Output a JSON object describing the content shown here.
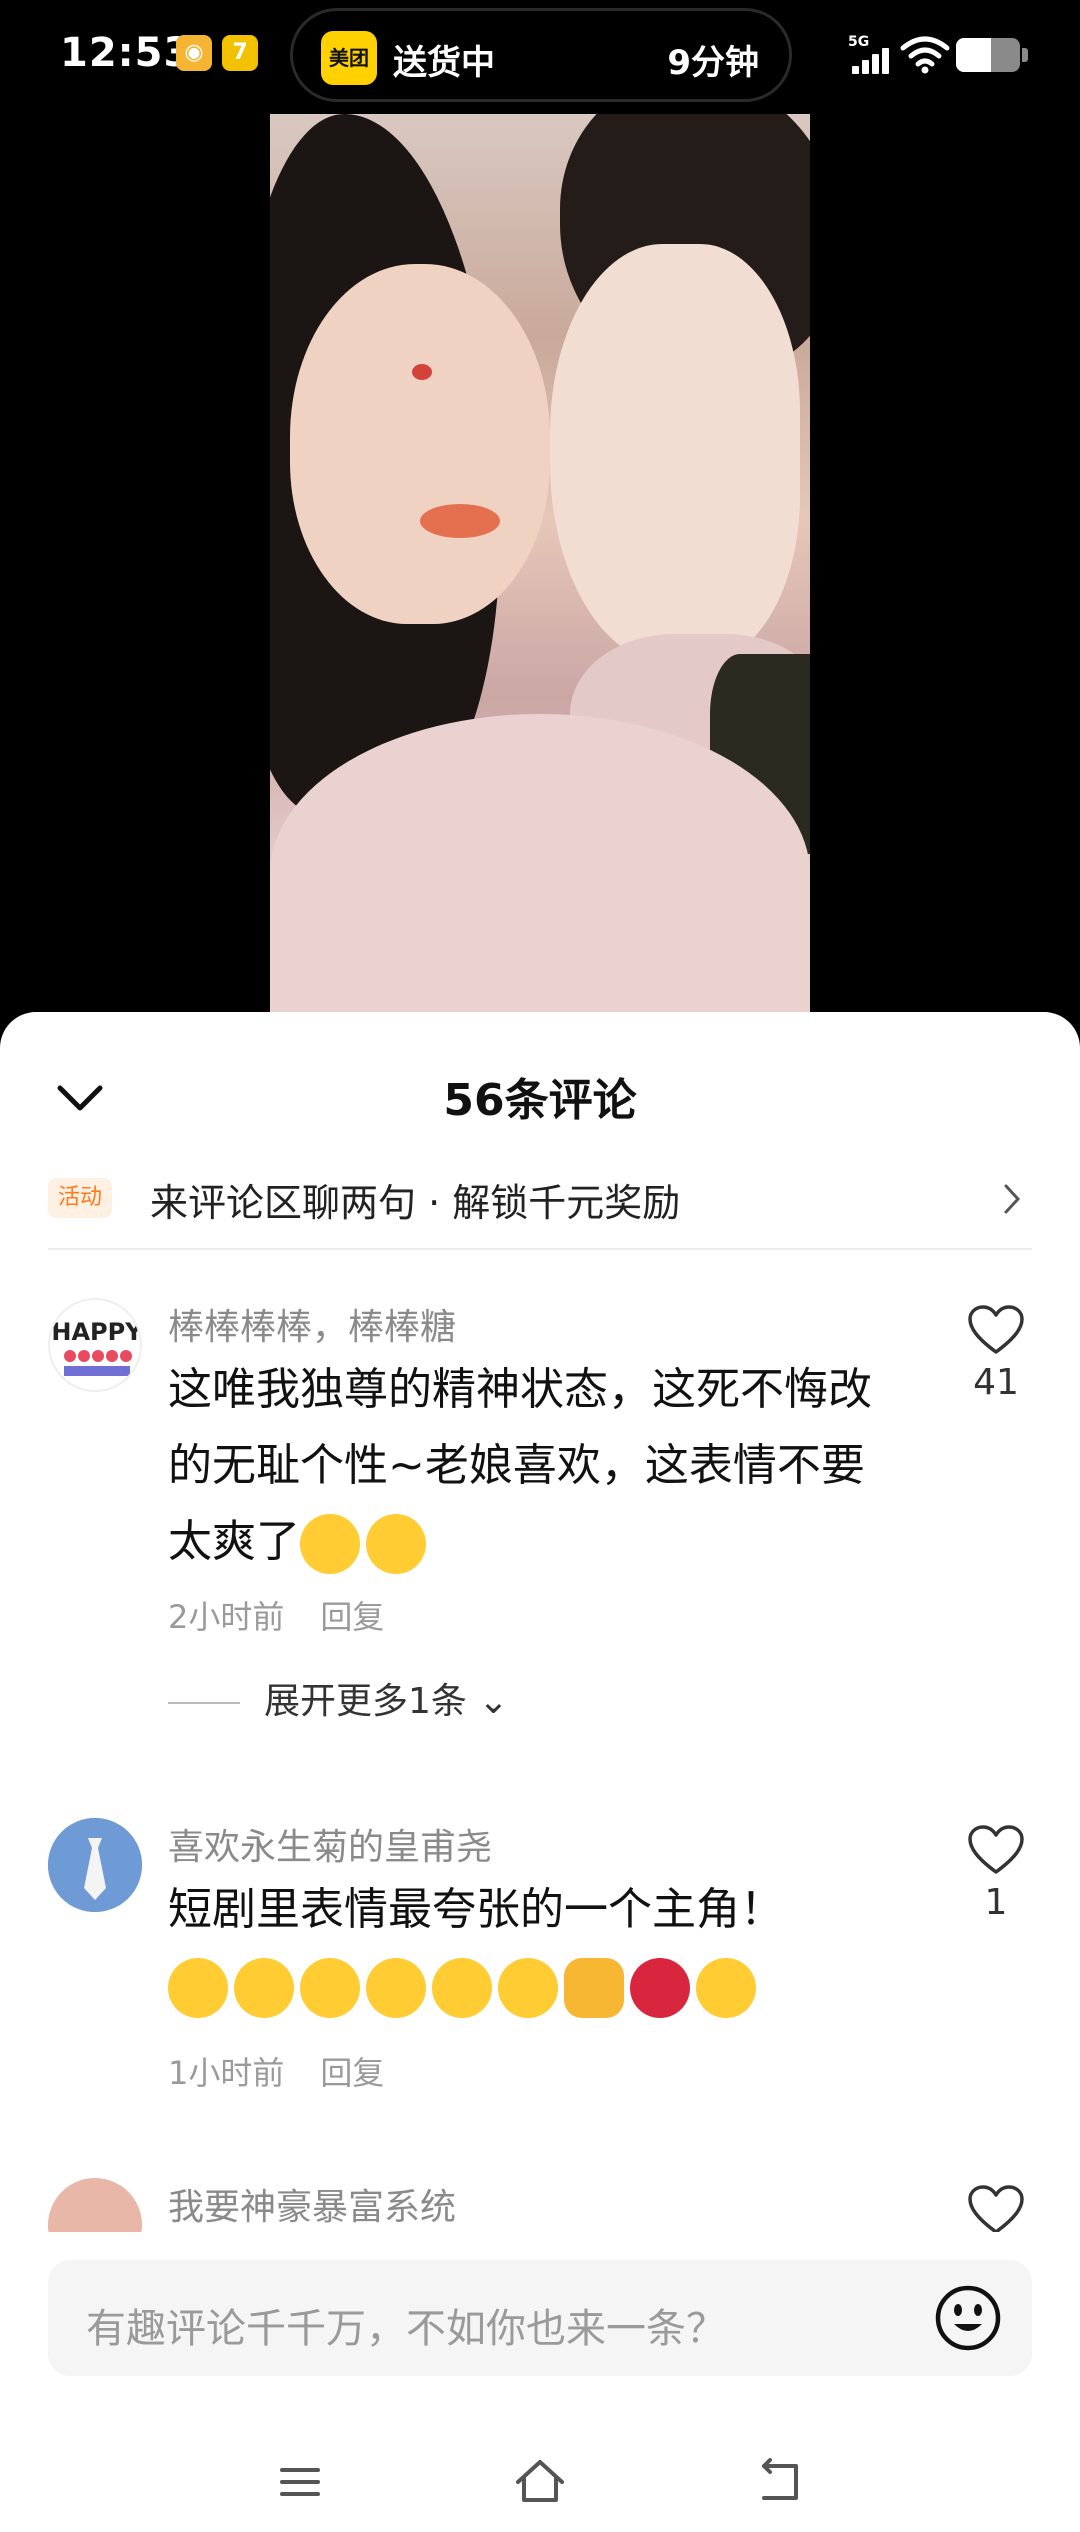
{
  "status_bar": {
    "time": "12:53",
    "island_logo": "美团",
    "island_status": "送货中",
    "island_eta": "9分钟",
    "network": "5G",
    "battery_level": 0.55
  },
  "comments_sheet": {
    "title": "56条评论",
    "promo_badge": "活动",
    "promo_text": "来评论区聊两句 · 解锁千元奖励",
    "comments": [
      {
        "user": "棒棒棒棒，棒棒糖",
        "text": "这唯我独尊的精神状态，这死不悔改的无耻个性~老娘喜欢，这表情不要太爽了",
        "emojis": [
          "heart-eyes-emoji",
          "heart-eyes-emoji"
        ],
        "time": "2小时前",
        "reply": "回复",
        "likes": "41",
        "expand": "展开更多1条"
      },
      {
        "user": "喜欢永生菊的皇甫尧",
        "text": "短剧里表情最夸张的一个主角！",
        "emojis": [
          "crying-emoji",
          "crying-emoji",
          "crying-emoji",
          "crying-emoji",
          "crying-emoji",
          "tears-of-joy-emoji",
          "clap-emoji",
          "rose-emoji",
          "heart-eyes-emoji"
        ],
        "time": "1小时前",
        "reply": "回复",
        "likes": "1"
      },
      {
        "user": "我要神豪暴富系统"
      }
    ],
    "input_placeholder": "有趣评论千千万，不如你也来一条？"
  },
  "colors": {
    "accent_orange": "#ff7a1a",
    "meituan_yellow": "#ffd100"
  }
}
